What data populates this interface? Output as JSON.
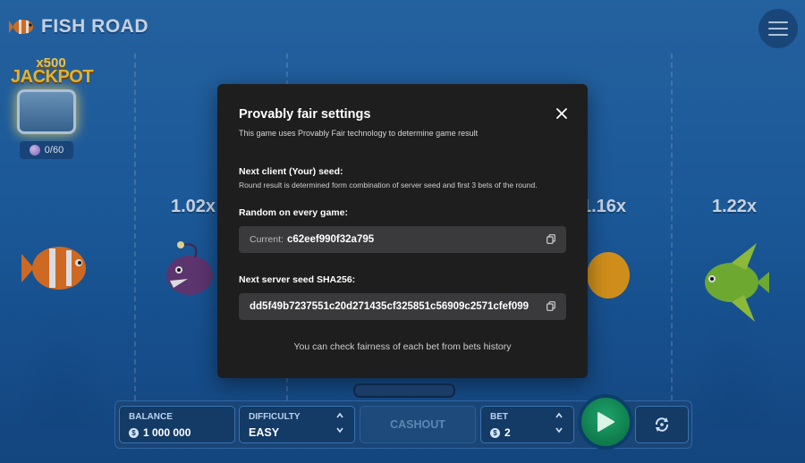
{
  "game": {
    "logo_text": "FISH ROAD",
    "jackpot_multiplier": "x500",
    "jackpot_label": "JACKPOT",
    "jackpot_counter": "0/60"
  },
  "multipliers": [
    "1.02x",
    "1.16x",
    "1.22x"
  ],
  "modal": {
    "title": "Provably fair settings",
    "subtitle": "This game uses Provably Fair technology to determine game result",
    "client_seed_title": "Next client (Your) seed:",
    "client_seed_desc": "Round result is determined form combination of server seed and first 3 bets of the round.",
    "random_title": "Random on every game:",
    "current_label": "Current:",
    "current_value": "c62eef990f32a795",
    "server_seed_title": "Next server seed SHA256:",
    "server_seed_value": "dd5f49b7237551c20d271435cf325851c56909c2571cfef099",
    "footer_text": "You can check fairness of each bet from bets history"
  },
  "controls": {
    "balance_label": "BALANCE",
    "balance_value": "1 000 000",
    "difficulty_label": "DIFFICULTY",
    "difficulty_value": "EASY",
    "cashout_label": "CASHOUT",
    "bet_label": "BET",
    "bet_value": "2"
  },
  "icons": {
    "menu": "hamburger-menu-icon",
    "close": "close-icon",
    "copy": "copy-icon",
    "play": "play-icon",
    "autoplay": "autoplay-icon",
    "currency": "dollar-coin-icon"
  },
  "colors": {
    "modal_bg": "#1e1e1f",
    "field_bg": "#3a3a3c",
    "play_green": "#1ea56a",
    "water_blue": "#1f64aa"
  }
}
